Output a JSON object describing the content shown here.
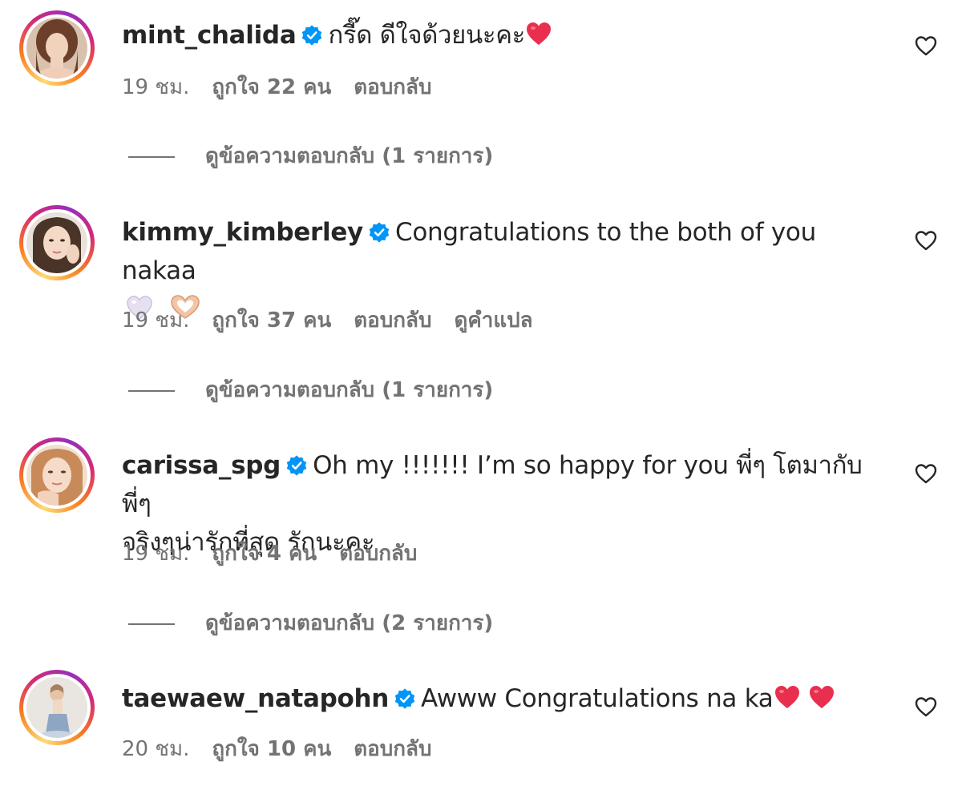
{
  "comments": [
    {
      "username": "mint_chalida",
      "text": "กรี๊ด ดีใจด้วยนะคะ",
      "time": "19 ชม.",
      "likes": "ถูกใจ 22 คน",
      "reply": "ตอบกลับ",
      "view_replies": "ดูข้อความตอบกลับ (1 รายการ)"
    },
    {
      "username": "kimmy_kimberley",
      "text": "Congratulations to the both of you nakaa",
      "time": "19 ชม.",
      "likes": "ถูกใจ 37 คน",
      "reply": "ตอบกลับ",
      "translate": "ดูคำแปล",
      "view_replies": "ดูข้อความตอบกลับ (1 รายการ)"
    },
    {
      "username": "carissa_spg",
      "text": "Oh my !!!!!!! I’m so happy for you พี่ๆ โตมากับพี่ๆ",
      "text_line2": "จริงๆน่ารักที่สุด รักนะคะ",
      "time": "19 ชม.",
      "likes": "ถูกใจ 4 คน",
      "reply": "ตอบกลับ",
      "view_replies": "ดูข้อความตอบกลับ (2 รายการ)"
    },
    {
      "username": "taewaew_natapohn",
      "text": "Awww Congratulations na ka",
      "time": "20 ชม.",
      "likes": "ถูกใจ 10 คน",
      "reply": "ตอบกลับ"
    }
  ],
  "icons": {
    "verified": "verified-badge-icon",
    "like": "heart-outline-icon",
    "emoji_red_heart": "red-heart-emoji",
    "emoji_white_heart": "white-heart-emoji",
    "emoji_heart_hands": "heart-hands-emoji"
  },
  "colors": {
    "verified_blue": "#0095f6",
    "text_primary": "#262626",
    "text_secondary": "#737373",
    "heart_red": "#e8304e"
  }
}
